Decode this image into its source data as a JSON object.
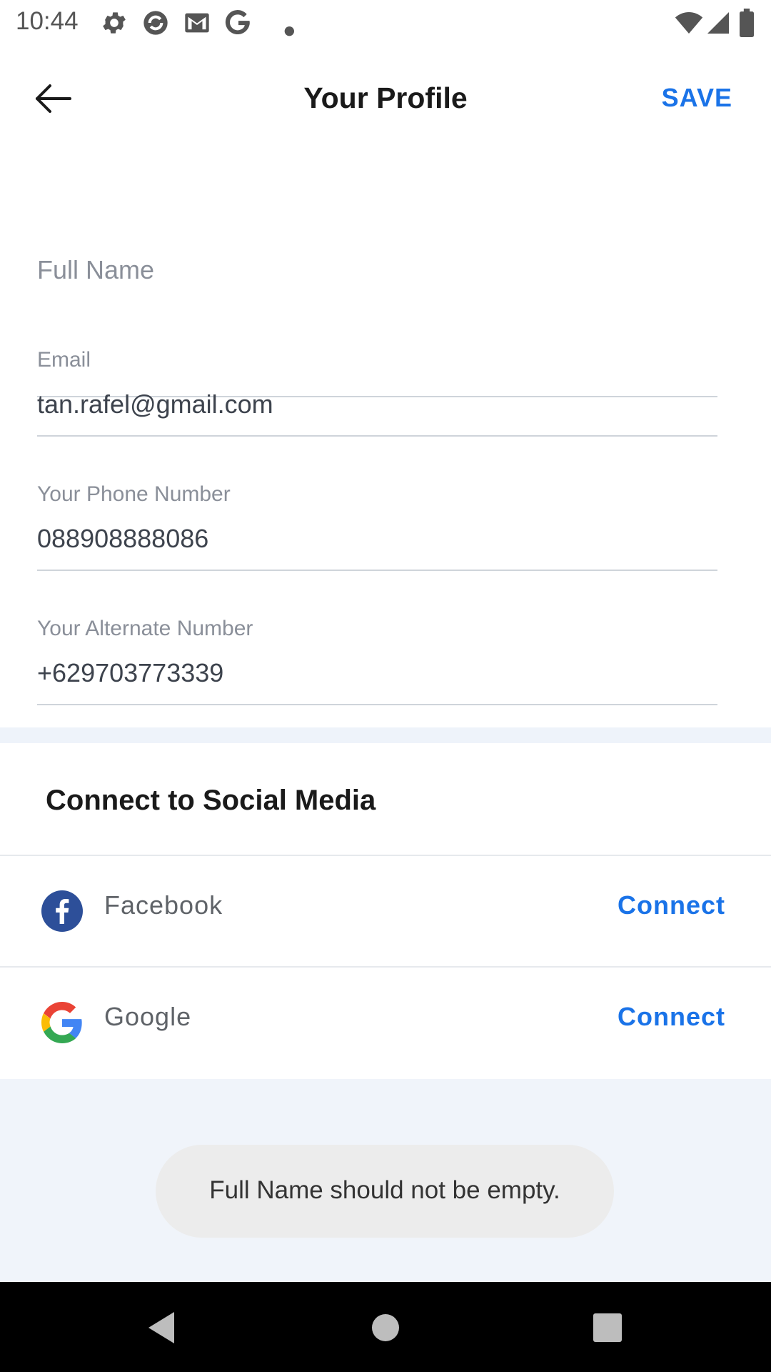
{
  "status_bar": {
    "time": "10:44",
    "left_icons": [
      "settings-icon",
      "sync-icon",
      "gmail-icon",
      "google-icon",
      "dot-icon"
    ],
    "right_icons": [
      "wifi-icon",
      "signal-icon",
      "battery-icon"
    ]
  },
  "header": {
    "title": "Your Profile",
    "save_label": "SAVE",
    "back_icon": "arrow-left-icon"
  },
  "form": {
    "full_name": {
      "placeholder": "Full Name",
      "value": ""
    },
    "email": {
      "label": "Email",
      "value": "tan.rafel@gmail.com"
    },
    "phone": {
      "label": "Your Phone Number",
      "value": "088908888086"
    },
    "alternate": {
      "label": "Your Alternate Number",
      "value": "+629703773339"
    }
  },
  "social": {
    "title": "Connect to Social Media",
    "items": [
      {
        "name": "Facebook",
        "action": "Connect",
        "icon": "facebook-icon"
      },
      {
        "name": "Google",
        "action": "Connect",
        "icon": "google-icon"
      }
    ]
  },
  "toast": {
    "message": "Full Name should not be empty."
  },
  "nav": {
    "icons": [
      "back-triangle-icon",
      "home-circle-icon",
      "recents-square-icon"
    ]
  },
  "colors": {
    "accent": "#1a73e8",
    "facebook": "#2d4f99",
    "band": "#eef3fa"
  }
}
